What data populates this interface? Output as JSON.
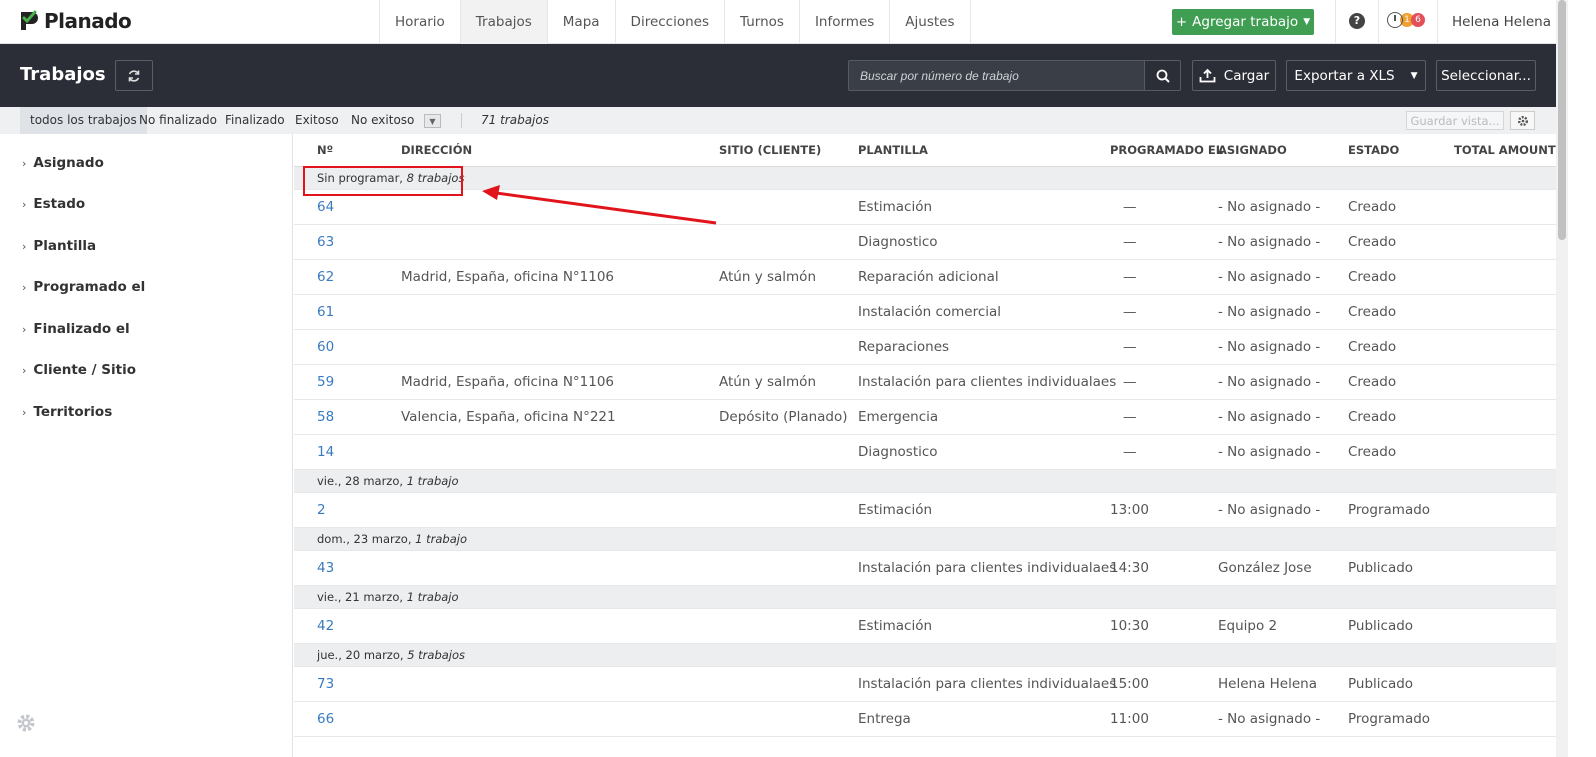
{
  "app": {
    "brand": "Planado"
  },
  "nav": {
    "items": [
      "Horario",
      "Trabajos",
      "Mapa",
      "Direcciones",
      "Turnos",
      "Informes",
      "Ajustes"
    ],
    "active": "Trabajos"
  },
  "topbar": {
    "add_job_label": "Agregar trabajo",
    "help_label": "?",
    "badge_orange": "1",
    "badge_red": "6",
    "user_name": "Helena Helena"
  },
  "header": {
    "title": "Trabajos",
    "search_placeholder": "Buscar por número de trabajo",
    "upload_label": "Cargar",
    "export_label": "Exportar a XLS",
    "select_label": "Seleccionar..."
  },
  "filters": {
    "tabs": [
      "todos los trabajos",
      "No finalizado",
      "Finalizado",
      "Exitoso",
      "No exitoso"
    ],
    "active": "todos los trabajos",
    "count": "71 trabajos",
    "save_view_label": "Guardar vista..."
  },
  "sidebar": {
    "items": [
      "Asignado",
      "Estado",
      "Plantilla",
      "Programado el",
      "Finalizado el",
      "Cliente / Sitio",
      "Territorios"
    ]
  },
  "table": {
    "columns": [
      "Nº",
      "DIRECCIÓN",
      "SITIO (CLIENTE)",
      "PLANTILLA",
      "PROGRAMADO EL",
      "ASIGNADO",
      "ESTADO",
      "TOTAL AMOUNT"
    ],
    "groups": [
      {
        "label": "Sin programar,",
        "count": "8 trabajos",
        "rows": [
          {
            "num": "64",
            "address": "",
            "site": "",
            "template": "Estimación",
            "scheduled": "—",
            "assigned": "- No asignado -",
            "status": "Creado",
            "total": ""
          },
          {
            "num": "63",
            "address": "",
            "site": "",
            "template": "Diagnostico",
            "scheduled": "—",
            "assigned": "- No asignado -",
            "status": "Creado",
            "total": ""
          },
          {
            "num": "62",
            "address": "Madrid, España, oficina N°1106",
            "site": "Atún y salmón",
            "template": "Reparación adicional",
            "scheduled": "—",
            "assigned": "- No asignado -",
            "status": "Creado",
            "total": ""
          },
          {
            "num": "61",
            "address": "",
            "site": "",
            "template": "Instalación comercial",
            "scheduled": "—",
            "assigned": "- No asignado -",
            "status": "Creado",
            "total": ""
          },
          {
            "num": "60",
            "address": "",
            "site": "",
            "template": "Reparaciones",
            "scheduled": "—",
            "assigned": "- No asignado -",
            "status": "Creado",
            "total": ""
          },
          {
            "num": "59",
            "address": "Madrid, España, oficina N°1106",
            "site": "Atún y salmón",
            "template": "Instalación para clientes individualaes",
            "scheduled": "—",
            "assigned": "- No asignado -",
            "status": "Creado",
            "total": ""
          },
          {
            "num": "58",
            "address": "Valencia, España, oficina N°221",
            "site": "Depósito (Planado)",
            "template": "Emergencia",
            "scheduled": "—",
            "assigned": "- No asignado -",
            "status": "Creado",
            "total": ""
          },
          {
            "num": "14",
            "address": "",
            "site": "",
            "template": "Diagnostico",
            "scheduled": "—",
            "assigned": "- No asignado -",
            "status": "Creado",
            "total": ""
          }
        ]
      },
      {
        "label": "vie., 28 marzo,",
        "count": "1 trabajo",
        "rows": [
          {
            "num": "2",
            "address": "",
            "site": "",
            "template": "Estimación",
            "scheduled": "13:00",
            "assigned": "- No asignado -",
            "status": "Programado",
            "total": ""
          }
        ]
      },
      {
        "label": "dom., 23 marzo,",
        "count": "1 trabajo",
        "rows": [
          {
            "num": "43",
            "address": "",
            "site": "",
            "template": "Instalación para clientes individualaes",
            "scheduled": "14:30",
            "assigned": "González Jose",
            "status": "Publicado",
            "total": ""
          }
        ]
      },
      {
        "label": "vie., 21 marzo,",
        "count": "1 trabajo",
        "rows": [
          {
            "num": "42",
            "address": "",
            "site": "",
            "template": "Estimación",
            "scheduled": "10:30",
            "assigned": "Equipo 2",
            "status": "Publicado",
            "total": ""
          }
        ]
      },
      {
        "label": "jue., 20 marzo,",
        "count": "5 trabajos",
        "rows": [
          {
            "num": "73",
            "address": "",
            "site": "",
            "template": "Instalación para clientes individualaes",
            "scheduled": "15:00",
            "assigned": "Helena Helena",
            "status": "Publicado",
            "total": ""
          },
          {
            "num": "66",
            "address": "",
            "site": "",
            "template": "Entrega",
            "scheduled": "11:00",
            "assigned": "- No asignado -",
            "status": "Programado",
            "total": ""
          }
        ]
      }
    ]
  },
  "colors": {
    "brand_green": "#3f9e52",
    "dark_header": "#2b2e36",
    "link_blue": "#3a7bbf",
    "annotation_red": "#e1141c"
  }
}
